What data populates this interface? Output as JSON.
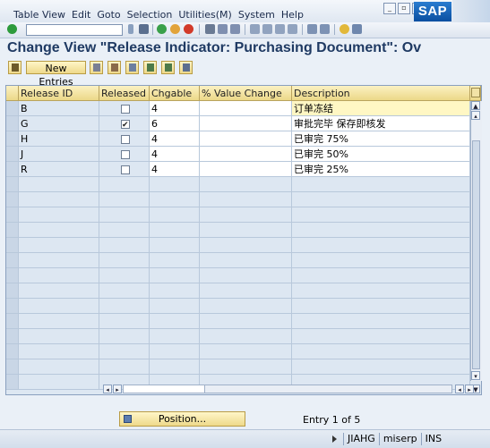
{
  "menu": [
    "Table View",
    "Edit",
    "Goto",
    "Selection",
    "Utilities(M)",
    "System",
    "Help"
  ],
  "logo": "SAP",
  "title": "Change View \"Release Indicator: Purchasing Document\": Ov",
  "toolbar": {
    "new_entries_label": "New Entries"
  },
  "table": {
    "columns": [
      "Release ID",
      "Released",
      "Chgable",
      "% Value Change",
      "Description"
    ],
    "rows": [
      {
        "release_id": "B",
        "released": false,
        "chgable": "4",
        "value_change": "",
        "description": "订单冻结"
      },
      {
        "release_id": "G",
        "released": true,
        "chgable": "6",
        "value_change": "",
        "description": "审批完毕 保存即核发"
      },
      {
        "release_id": "H",
        "released": false,
        "chgable": "4",
        "value_change": "",
        "description": "已审完 75%"
      },
      {
        "release_id": "J",
        "released": false,
        "chgable": "4",
        "value_change": "",
        "description": "已审完 50%"
      },
      {
        "release_id": "R",
        "released": false,
        "chgable": "4",
        "value_change": "",
        "description": "已审完 25%"
      }
    ],
    "empty_rows": 14
  },
  "footer": {
    "position_label": "Position...",
    "entry_text": "Entry 1 of 5"
  },
  "status": {
    "system": "JIAHG",
    "server": "miserp",
    "mode": "INS"
  },
  "colors": {
    "title": "#1f3a63",
    "header_bg": "#ecd888",
    "row_bg": "#dde7f2",
    "focus_row": "#fff7c4"
  }
}
